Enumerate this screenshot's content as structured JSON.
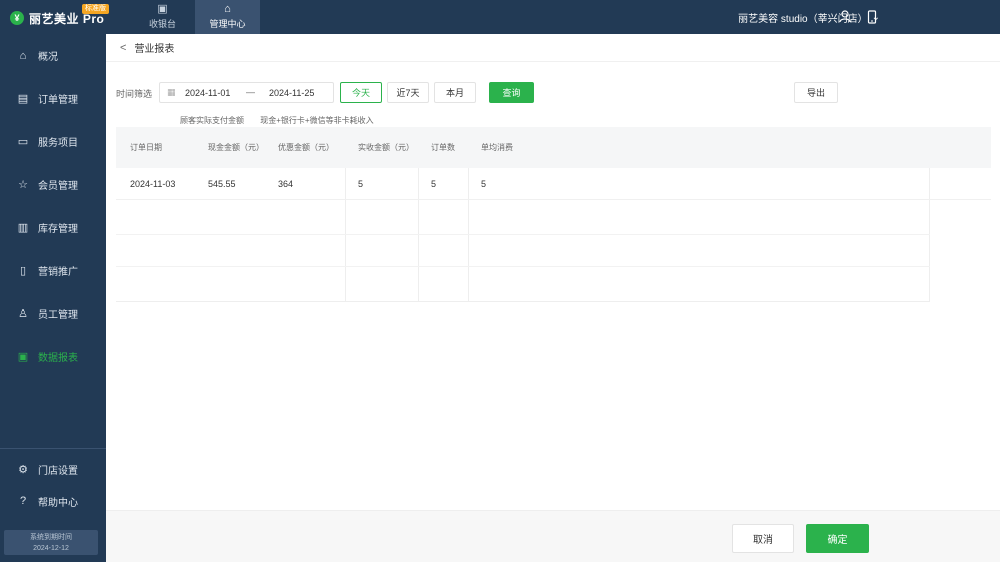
{
  "app": {
    "logo_mark": "¥",
    "name": "丽艺美业 Pro",
    "badge": "标准版"
  },
  "topnav": [
    {
      "icon": "▣",
      "label": "收银台"
    },
    {
      "icon": "⌂",
      "label": "管理中心"
    }
  ],
  "store": {
    "name": "丽艺美容 studio（莘兴门店）",
    "chevron": "⌄"
  },
  "sidebar": {
    "items": [
      {
        "icon": "⌂",
        "label": "概况"
      },
      {
        "icon": "▤",
        "label": "订单管理"
      },
      {
        "icon": "▭",
        "label": "服务项目"
      },
      {
        "icon": "☆",
        "label": "会员管理"
      },
      {
        "icon": "▥",
        "label": "库存管理"
      },
      {
        "icon": "▯",
        "label": "营销推广"
      },
      {
        "icon": "♙",
        "label": "员工管理"
      },
      {
        "icon": "▣",
        "label": "数据报表"
      }
    ],
    "bottom": [
      {
        "icon": "⚙",
        "label": "门店设置"
      },
      {
        "icon": "?",
        "label": "帮助中心"
      }
    ],
    "expire_label": "系统到期时间",
    "expire_date": "2024-12-12"
  },
  "page": {
    "back_icon": "<",
    "title": "营业报表"
  },
  "filter": {
    "label": "时间筛选",
    "calendar_icon": "▦",
    "start_date": "2024-11-01",
    "separator": "—",
    "end_date": "2024-11-25",
    "today": "今天",
    "last7": "近7天",
    "this_month": "本月",
    "query": "查询",
    "export": "导出"
  },
  "notes": [
    "顾客实际支付金额",
    "现金+银行卡+微信等非卡耗收入"
  ],
  "table": {
    "headers": [
      "订单日期",
      "现金金额（元）",
      "优惠金额（元）",
      "实收金额（元）",
      "订单数",
      "单均消费"
    ],
    "rows": [
      [
        "2024-11-03",
        "545.55",
        "364",
        "5",
        "5",
        "5"
      ]
    ]
  },
  "footer": {
    "cancel": "取消",
    "confirm": "确定"
  },
  "colors": {
    "nav_bg": "#223a55",
    "accent": "#2bb24c"
  }
}
